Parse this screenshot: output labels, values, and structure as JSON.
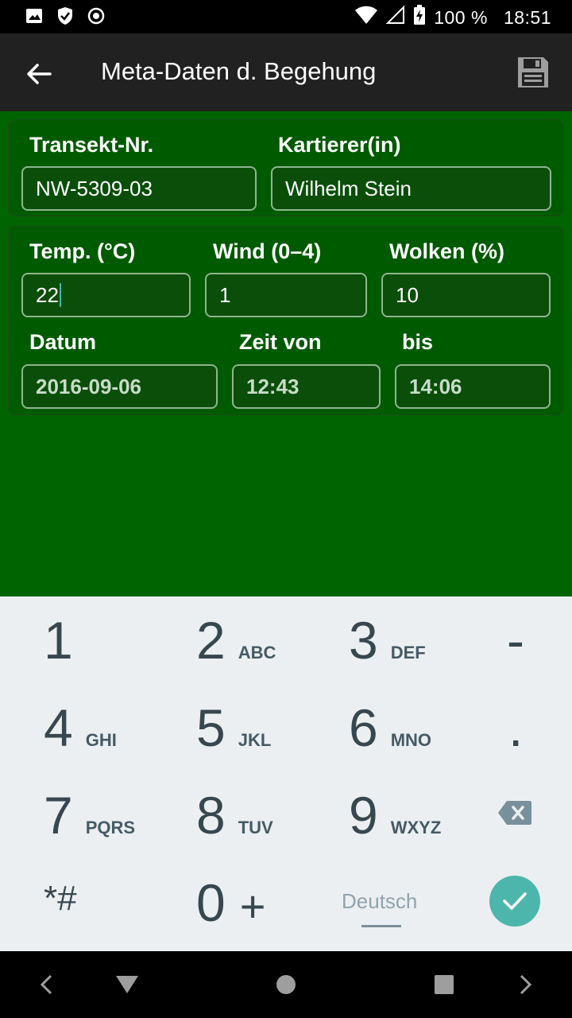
{
  "status_bar": {
    "battery": "100 %",
    "time": "18:51",
    "icons": [
      "image-icon",
      "shield-check-icon",
      "target-icon",
      "wifi-icon",
      "signal-icon",
      "battery-charging-icon"
    ]
  },
  "app_bar": {
    "title": "Meta-Daten d. Begehung",
    "back_icon": "arrow-left-icon",
    "save_icon": "floppy-disk-icon"
  },
  "form": {
    "transect": {
      "label": "Transekt-Nr.",
      "value": "NW-5309-03"
    },
    "mapper": {
      "label": "Kartierer(in)",
      "value": "Wilhelm Stein"
    },
    "temp": {
      "label": "Temp. (°C)",
      "value": "22"
    },
    "wind": {
      "label": "Wind (0–4)",
      "value": "1"
    },
    "clouds": {
      "label": "Wolken (%)",
      "value": "10"
    },
    "date": {
      "label": "Datum",
      "value": "2016-09-06"
    },
    "time_from": {
      "label": "Zeit von",
      "value": "12:43"
    },
    "time_to": {
      "label": "bis",
      "value": "14:06"
    }
  },
  "keyboard": {
    "keys": [
      {
        "num": "1",
        "sub": ""
      },
      {
        "num": "2",
        "sub": "ABC"
      },
      {
        "num": "3",
        "sub": "DEF"
      },
      {
        "num": "-",
        "sub": ""
      },
      {
        "num": "4",
        "sub": "GHI"
      },
      {
        "num": "5",
        "sub": "JKL"
      },
      {
        "num": "6",
        "sub": "MNO"
      },
      {
        "num": ".",
        "sub": ""
      },
      {
        "num": "7",
        "sub": "PQRS"
      },
      {
        "num": "8",
        "sub": "TUV"
      },
      {
        "num": "9",
        "sub": "WXYZ"
      },
      {
        "num": "*#",
        "sub": ""
      },
      {
        "num": "0",
        "sub": "+"
      }
    ],
    "language": "Deutsch",
    "accent_color": "#4db6ac"
  },
  "colors": {
    "content_bg": "#006400",
    "appbar_bg": "#212121",
    "keyboard_bg": "#eceff1"
  }
}
